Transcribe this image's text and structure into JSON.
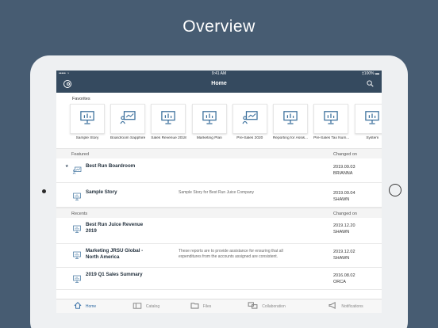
{
  "headline": "Overview",
  "status": {
    "left": "••••• ◔",
    "time": "9:41 AM",
    "right": "‡100% ▬"
  },
  "navbar": {
    "title": "Home"
  },
  "favorites": {
    "title": "Favorites",
    "items": [
      {
        "label": "Sample Story",
        "icon": "story-board-icon"
      },
      {
        "label": "Boardroom Sapphire",
        "icon": "boardroom-icon"
      },
      {
        "label": "Sales Revenue 2018",
        "icon": "story-board-icon"
      },
      {
        "label": "Marketing Plan",
        "icon": "story-board-icon"
      },
      {
        "label": "Pre-Sales 2020",
        "icon": "boardroom-icon"
      },
      {
        "label": "Reporting for Assis...",
        "icon": "story-board-icon"
      },
      {
        "label": "Pre-Sales Tax Num...",
        "icon": "story-board-icon"
      },
      {
        "label": "System",
        "icon": "story-board-icon"
      }
    ]
  },
  "featured": {
    "header": "Featured",
    "changed_header": "Changed on",
    "rows": [
      {
        "name": "Best Run Boardroom",
        "desc": "",
        "date": "2019.09.03",
        "user": "BRIANNA",
        "starred": "★"
      },
      {
        "name": "Sample Story",
        "desc": "Sample Story for Best Run Juice Company",
        "date": "2019.09.04",
        "user": "SHAWN",
        "starred": ""
      }
    ]
  },
  "recents": {
    "header": "Recents",
    "changed_header": "Changed on",
    "rows": [
      {
        "name": "Best Run Juice Revenue 2019",
        "desc": "",
        "date": "2019.12.20",
        "user": "SHAWN"
      },
      {
        "name": "Marketing JRSU Global - North America",
        "desc": "These reports are to provide assistance for ensuring that all expenditures from the accounts assigned are consistent.",
        "date": "2019.12.02",
        "user": "SHAWN"
      },
      {
        "name": "2019 Q1 Sales Summary",
        "desc": "",
        "date": "2016.08.02",
        "user": "ORCA"
      }
    ]
  },
  "tabs": [
    {
      "label": "Home",
      "icon": "home-icon",
      "active": true
    },
    {
      "label": "Catalog",
      "icon": "catalog-icon",
      "active": false
    },
    {
      "label": "Files",
      "icon": "folder-icon",
      "active": false
    },
    {
      "label": "Collaboration",
      "icon": "chat-icon",
      "active": false
    },
    {
      "label": "Notifications",
      "icon": "megaphone-icon",
      "active": false
    }
  ],
  "colors": {
    "background": "#475c72",
    "shell": "#354a5f",
    "accent": "#2f6aa3",
    "icon": "#3a6f9c"
  }
}
